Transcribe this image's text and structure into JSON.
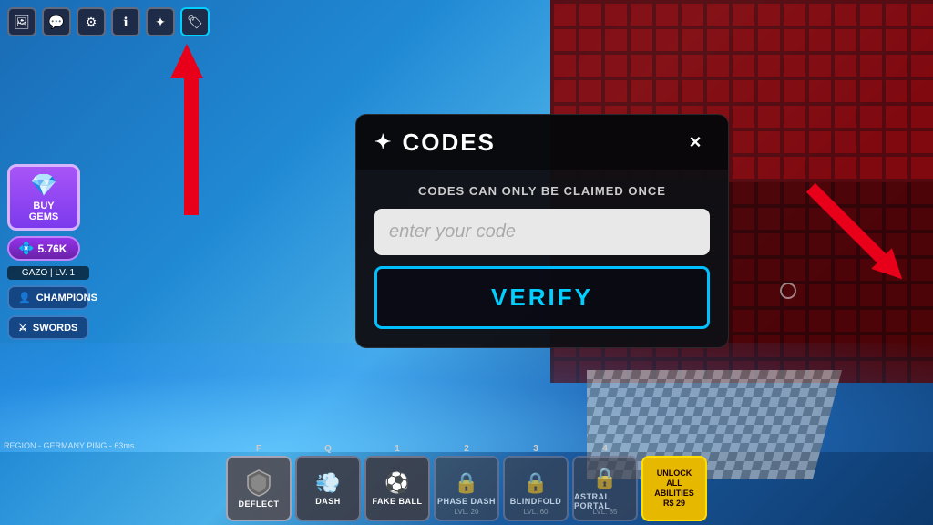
{
  "background": {
    "color_top": "#1a6bb5",
    "color_bottom": "#0d3a6e"
  },
  "top_icons": [
    {
      "name": "camera-icon",
      "symbol": "🖼",
      "label": "screenshot"
    },
    {
      "name": "chat-icon",
      "symbol": "💬",
      "label": "chat"
    },
    {
      "name": "settings-icon",
      "symbol": "⚙",
      "label": "settings"
    },
    {
      "name": "info-icon",
      "symbol": "ℹ",
      "label": "info"
    },
    {
      "name": "star-icon",
      "symbol": "✦",
      "label": "special"
    },
    {
      "name": "codes-icon",
      "symbol": "🏷",
      "label": "codes",
      "active": true
    }
  ],
  "sidebar": {
    "gems_label": "BUY GEMS",
    "gems_symbol": "💎",
    "currency_value": "5.76K",
    "player_name": "GAZO | LV. 1",
    "menu_items": [
      {
        "label": "CHAMPIONS",
        "icon": "👤"
      },
      {
        "label": "SWORDS",
        "icon": "⚔"
      }
    ]
  },
  "codes_modal": {
    "title": "CODES",
    "sparkle": "✦",
    "close_label": "×",
    "notice": "CODES CAN ONLY BE CLAIMED ONCE",
    "input_placeholder": "enter your code",
    "verify_label": "VERIFY"
  },
  "bottom_bar": {
    "slots": [
      {
        "key": "F",
        "name": "DEFLECT",
        "icon": "🛡",
        "locked": false,
        "level": ""
      },
      {
        "key": "Q",
        "name": "DASH",
        "icon": "💨",
        "locked": false,
        "level": ""
      },
      {
        "key": "1",
        "name": "FAKE BALL",
        "icon": "⚽",
        "locked": false,
        "level": ""
      },
      {
        "key": "2",
        "name": "PHASE DASH",
        "icon": "🔒",
        "locked": true,
        "level": "LVL. 20"
      },
      {
        "key": "3",
        "name": "BLINDFOLD",
        "icon": "🔒",
        "locked": true,
        "level": "LVL. 60"
      },
      {
        "key": "4",
        "name": "ASTRAL PORTAL",
        "icon": "🔒",
        "locked": true,
        "level": "LVL. 85"
      }
    ],
    "unlock_btn": {
      "line1": "UNLOCK",
      "line2": "ALL",
      "line3": "ABILITIES",
      "line4": "R$ 29"
    }
  },
  "region_info": "REGION - GERMANY    PING - 63ms",
  "arrows": {
    "up_arrow_label": "arrow pointing up to codes icon",
    "right_arrow_label": "arrow pointing to code input"
  }
}
